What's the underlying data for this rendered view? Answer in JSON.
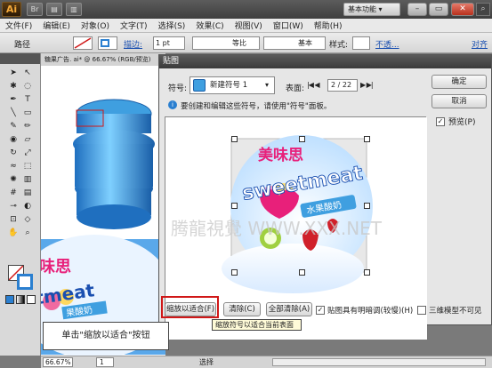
{
  "app": {
    "logo": "Ai",
    "workspace": "基本功能"
  },
  "menubar": [
    "文件(F)",
    "编辑(E)",
    "对象(O)",
    "文字(T)",
    "选择(S)",
    "效果(C)",
    "视图(V)",
    "窗口(W)",
    "帮助(H)"
  ],
  "control_bar": {
    "object_type": "路径",
    "stroke_label": "描边:",
    "stroke_weight": "1 pt",
    "profile": "等比",
    "brush": "基本",
    "style_label": "样式:",
    "opacity": "不透...",
    "extra": "对齐"
  },
  "document": {
    "tab": "糖果广告. ai* @ 66.67% (RGB/预览)",
    "zoom": "66.67%",
    "page": "1",
    "status": "选择"
  },
  "dialog": {
    "title": "贴图",
    "symbol_label": "符号:",
    "symbol_value": "新建符号 1",
    "surface_label": "表面:",
    "surface_value": "2 / 22",
    "hint": "要创建和编辑这些符号，请使用\"符号\"面板。",
    "ok": "确定",
    "cancel": "取消",
    "preview_label": "预览(P)",
    "preview_checked": true,
    "scale_to_fit": "缩放以适合(F)",
    "clear": "清除(C)",
    "clear_all": "全部清除(A)",
    "shade_label": "贴图具有明暗调(较慢)(H)",
    "shade_checked": true,
    "invisible_label": "三维模型不可见",
    "invisible_checked": false
  },
  "artwork": {
    "brand_cn": "美味思",
    "brand_en": "sweetmeat",
    "flavor": "水果酸奶"
  },
  "watermark": "腾龍視覺 WWW.XXX.NET",
  "tooltip": "缩放符号以适合当前表面",
  "callout": "单击\"缩放以适合\"按钮",
  "colors": {
    "accent_red": "#d01818",
    "candy_blue": "#3f9fe0",
    "brand_pink": "#e8207a",
    "title_bar": "#3e3e3e"
  },
  "icons": [
    "selection-tool-icon",
    "direct-select-icon",
    "magic-wand-icon",
    "lasso-icon",
    "pen-icon",
    "type-icon",
    "line-icon",
    "rect-icon",
    "brush-icon",
    "pencil-icon",
    "blob-brush-icon",
    "eraser-icon",
    "rotate-icon",
    "scale-icon",
    "warp-icon",
    "free-transform-icon",
    "symbol-sprayer-icon",
    "graph-icon",
    "mesh-icon",
    "gradient-icon",
    "eyedropper-icon",
    "blend-icon",
    "artboard-icon",
    "slice-icon",
    "hand-icon",
    "zoom-icon"
  ]
}
